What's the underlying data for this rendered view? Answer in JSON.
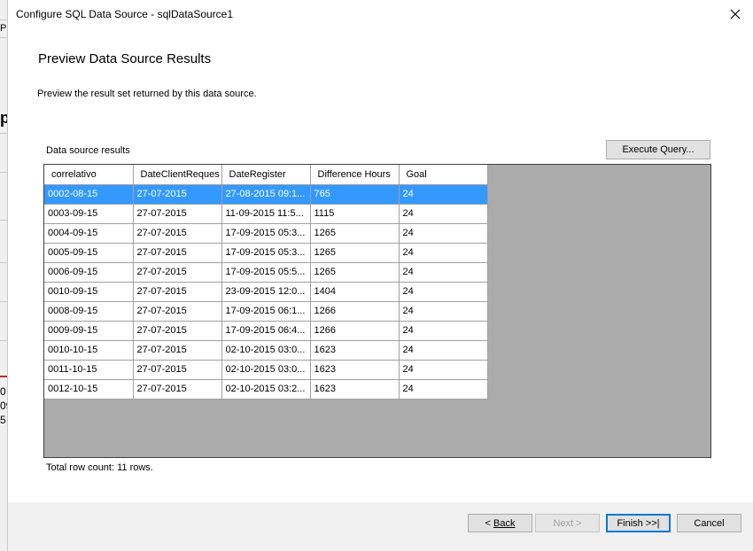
{
  "background_app": {
    "fragments": [
      "Pr",
      "p",
      "0",
      "09",
      "5"
    ]
  },
  "window": {
    "title": "Configure SQL Data Source - sqlDataSource1"
  },
  "page": {
    "heading": "Preview Data Source Results",
    "subtitle": "Preview the result set returned by this data source.",
    "results_label": "Data source results",
    "execute_button": "Execute Query...",
    "row_count_text": "Total row count: 11 rows."
  },
  "grid": {
    "columns": [
      "correlativo",
      "DateClientReques",
      "DateRegister",
      "Difference Hours",
      "Goal"
    ],
    "rows": [
      [
        "0002-08-15",
        "27-07-2015",
        "27-08-2015 09:1...",
        "765",
        "24"
      ],
      [
        "0003-09-15",
        "27-07-2015",
        "11-09-2015 11:5...",
        "1115",
        "24"
      ],
      [
        "0004-09-15",
        "27-07-2015",
        "17-09-2015 05:3...",
        "1265",
        "24"
      ],
      [
        "0005-09-15",
        "27-07-2015",
        "17-09-2015 05:3...",
        "1265",
        "24"
      ],
      [
        "0006-09-15",
        "27-07-2015",
        "17-09-2015 05:5...",
        "1265",
        "24"
      ],
      [
        "0010-09-15",
        "27-07-2015",
        "23-09-2015 12:0...",
        "1404",
        "24"
      ],
      [
        "0008-09-15",
        "27-07-2015",
        "17-09-2015 06:1...",
        "1266",
        "24"
      ],
      [
        "0009-09-15",
        "27-07-2015",
        "17-09-2015 06:4...",
        "1266",
        "24"
      ],
      [
        "0010-10-15",
        "27-07-2015",
        "02-10-2015 03:0...",
        "1623",
        "24"
      ],
      [
        "0011-10-15",
        "27-07-2015",
        "02-10-2015 03:0...",
        "1623",
        "24"
      ],
      [
        "0012-10-15",
        "27-07-2015",
        "02-10-2015 03:2...",
        "1623",
        "24"
      ]
    ],
    "selected_row": 0,
    "selection_color": "#3399ff"
  },
  "footer": {
    "back_prefix": "< ",
    "back_label": "Back",
    "next_label": "Next >",
    "finish_label": "Finish >>|",
    "cancel_label": "Cancel"
  },
  "icons": {
    "close": "close-icon"
  }
}
